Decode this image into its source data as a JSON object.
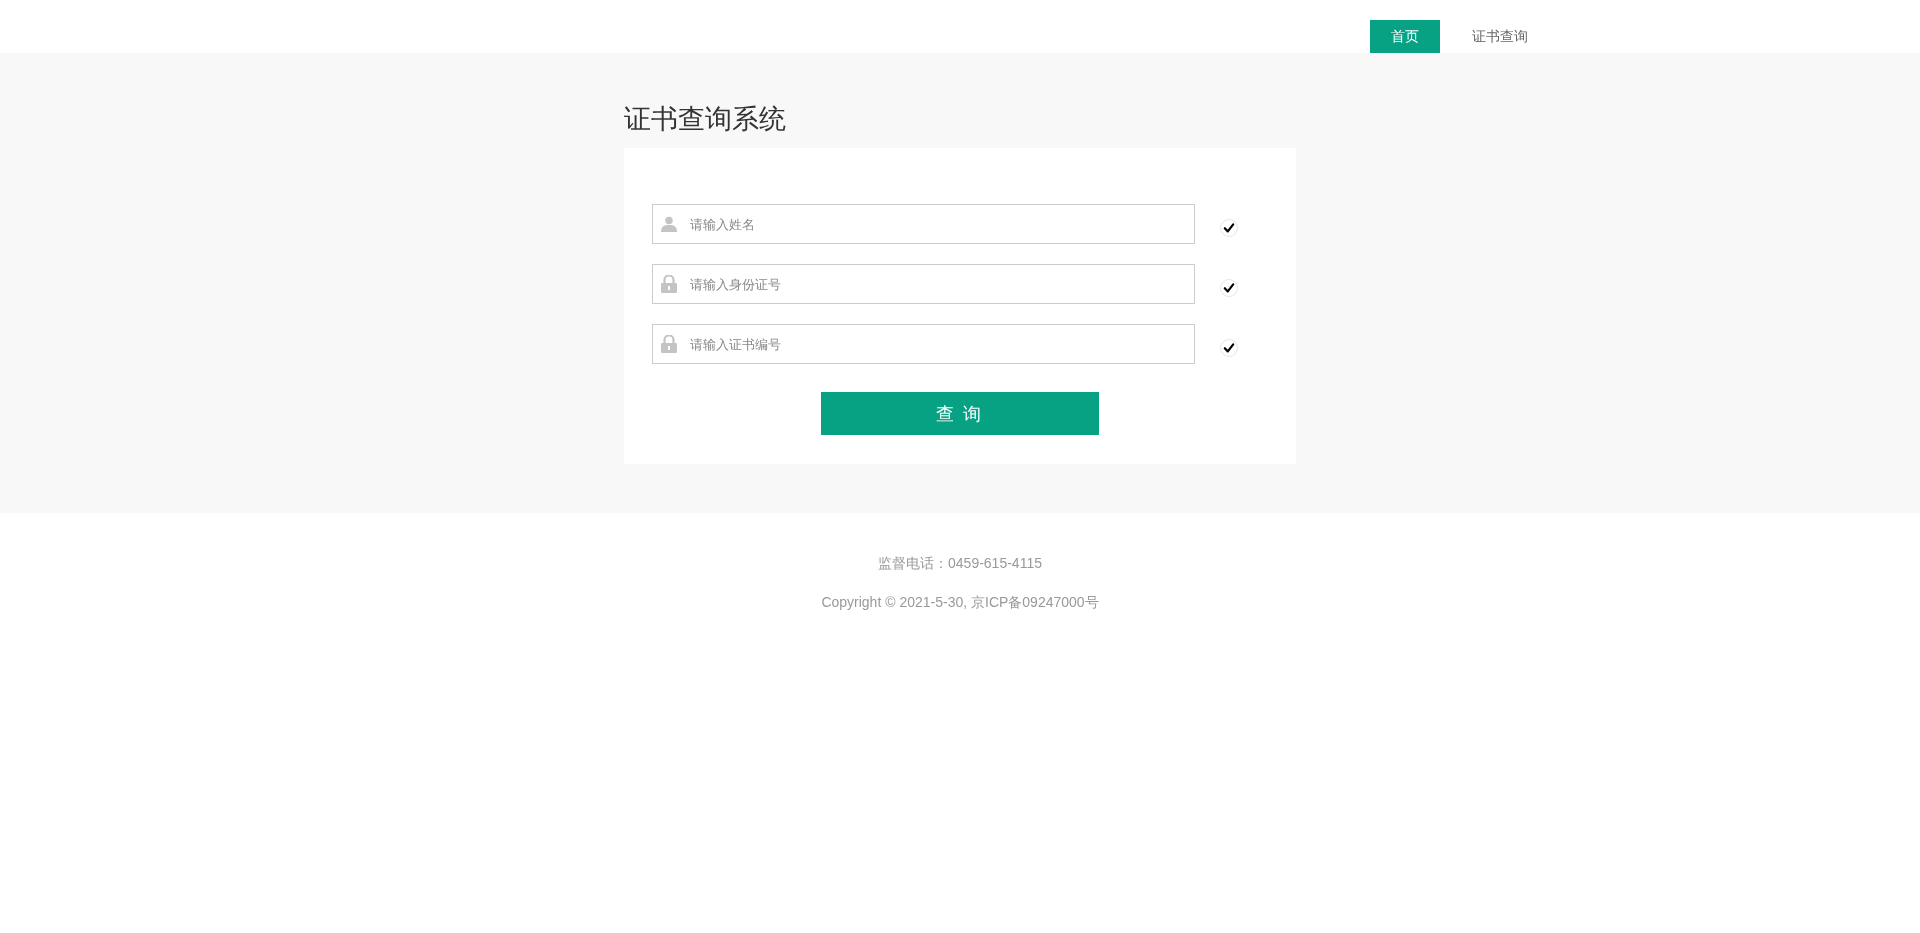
{
  "header": {
    "nav": [
      {
        "label": "首页",
        "selected": true
      },
      {
        "label": "证书查询",
        "selected": false
      }
    ]
  },
  "page": {
    "title": "证书查询系统"
  },
  "form": {
    "fields": [
      {
        "kind": "person",
        "placeholder": "请输入姓名",
        "valid": true
      },
      {
        "kind": "lock",
        "placeholder": "请输入身份证号",
        "valid": true
      },
      {
        "kind": "lock",
        "placeholder": "请输入证书编号",
        "valid": true
      }
    ],
    "submit": "查 询"
  },
  "footer": {
    "lines": [
      "监督电话：0459-615-4115",
      "Copyright © 2021-5-30, 京ICP备09247000号"
    ]
  }
}
